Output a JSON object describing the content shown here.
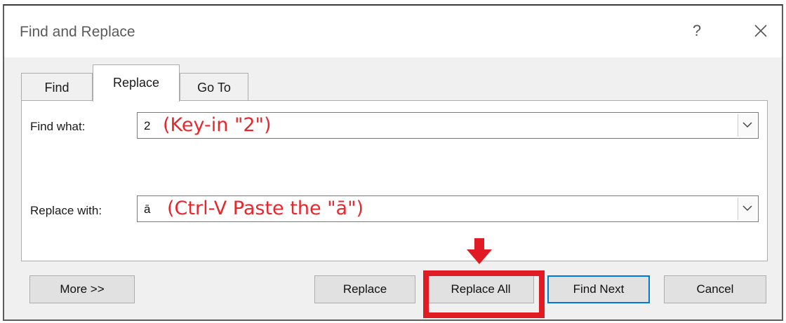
{
  "window": {
    "title": "Find and Replace",
    "help_symbol": "?"
  },
  "tabs": [
    {
      "label": "Find",
      "selected": false
    },
    {
      "label": "Replace",
      "selected": true
    },
    {
      "label": "Go To",
      "selected": false
    }
  ],
  "find": {
    "label": "Find what:",
    "value": "2",
    "annotation": "(Key-in \"2\")"
  },
  "replace": {
    "label": "Replace with:",
    "value": "ā",
    "annotation": "(Ctrl-V Paste the \"ā\")"
  },
  "buttons": {
    "more": "More >>",
    "replace": "Replace",
    "replace_all": "Replace All",
    "find_next": "Find Next",
    "cancel": "Cancel"
  },
  "colors": {
    "annotation": "#e8272d",
    "highlight": "#e11b23",
    "focus_border": "#0078d7"
  },
  "icons": [
    "help-icon",
    "close-icon",
    "dropdown-arrow-icon",
    "down-arrow-icon"
  ]
}
